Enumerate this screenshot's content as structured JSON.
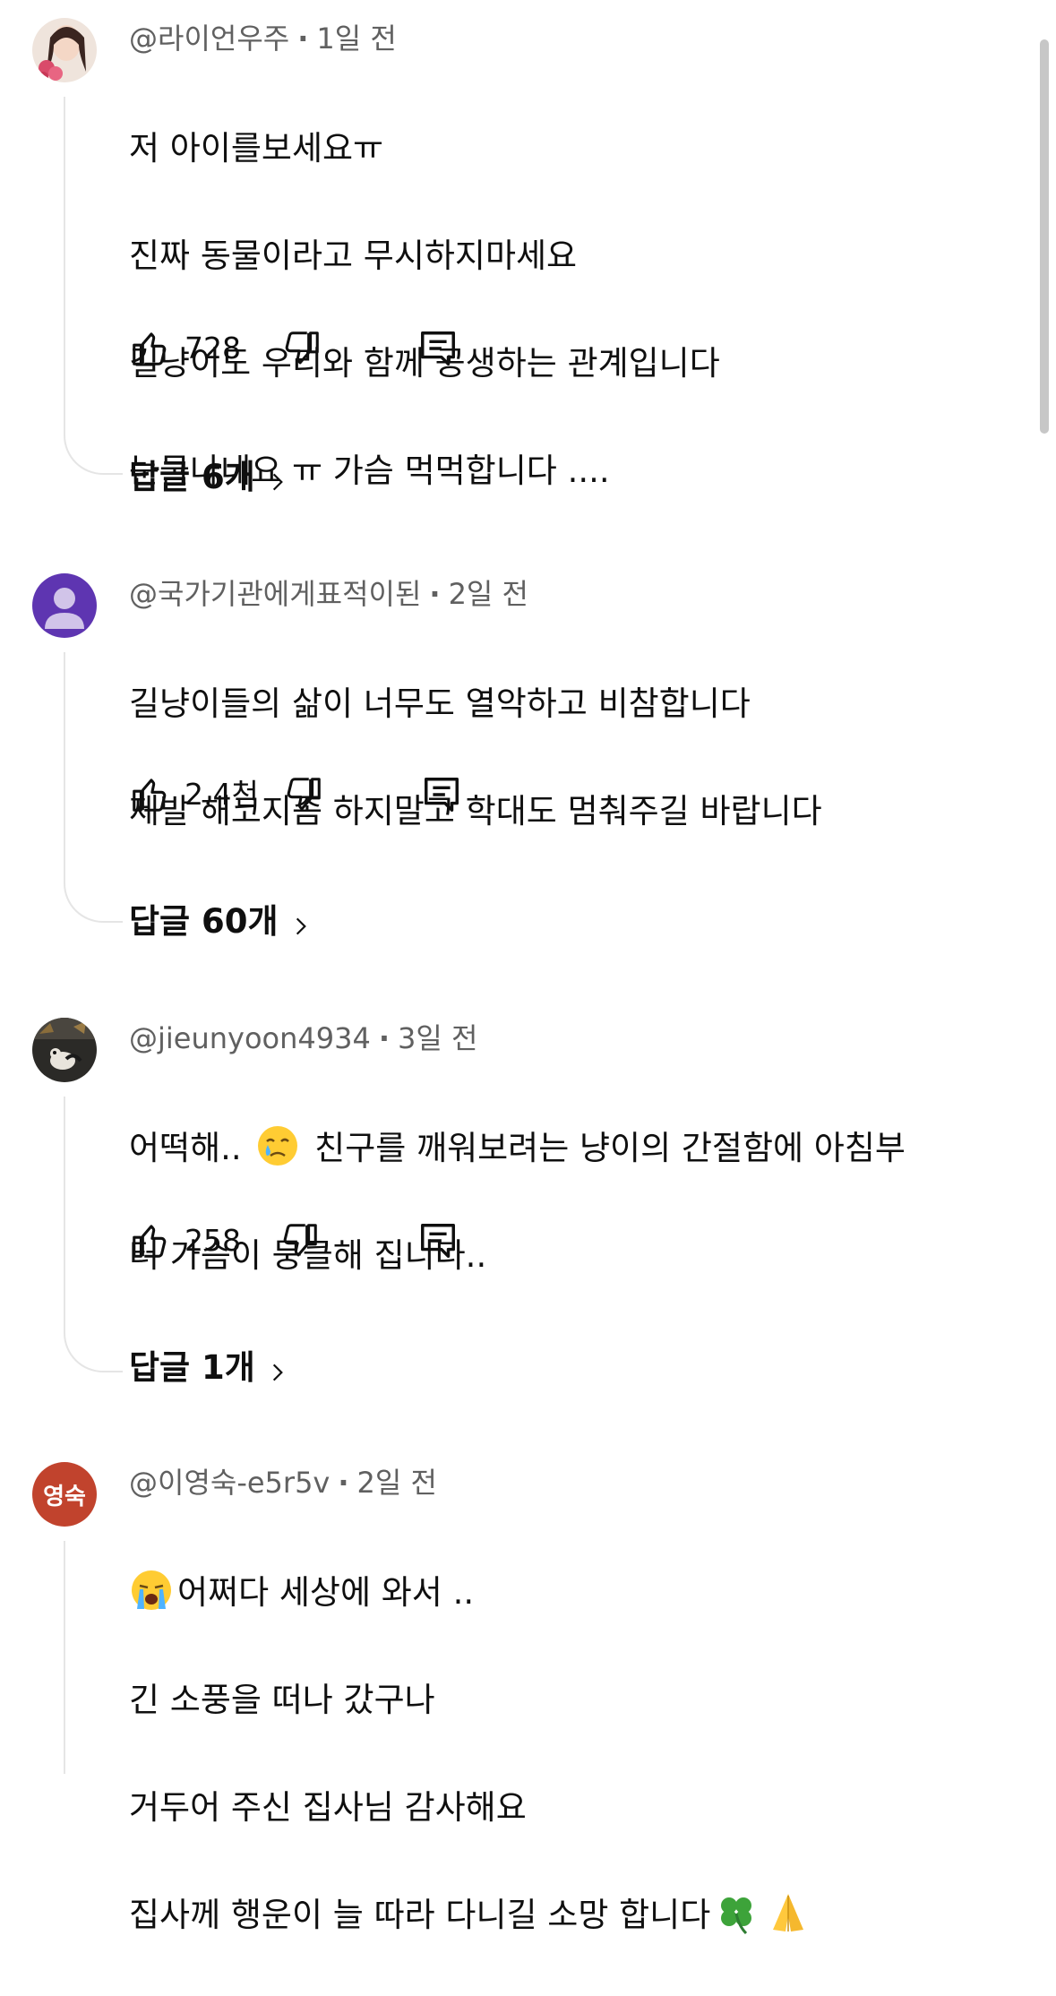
{
  "comments": [
    {
      "author": "@라이언우주",
      "time": "1일 전",
      "lines": [
        "저 아이를보세요ㅠ",
        "진짜  동물이라고 무시하지마세요",
        "길냥이도 우리와 함께 공생하는 관계입니다",
        "눈물나네요 ㅠ 가슴 먹먹합니다 ...."
      ],
      "likes": "728",
      "replies": "답글 6개",
      "avatar": "photo-woman-with-flowers"
    },
    {
      "author": "@국가기관에게표적이된",
      "time": "2일 전",
      "lines": [
        "길냥이들의 삶이 너무도 열악하고 비참합니다",
        "제발 해코지좀 하지말고 학대도 멈춰주길 바랍니다"
      ],
      "likes": "2.4천",
      "replies": "답글 60개",
      "avatar": "default-person",
      "avatar_color": "#5e35b1"
    },
    {
      "author": "@jieunyoon4934",
      "time": "3일 전",
      "line1_before": "어떡해.. ",
      "line1_after": " 친구를 깨워보려는 냥이의 간절함에 아침부",
      "line2": "터 가슴이 뭉클해 집니다..",
      "emoji": "crying-face",
      "likes": "258",
      "replies": "답글 1개",
      "avatar": "photo-dark-room-dog"
    },
    {
      "author": "@이영숙-e5r5v",
      "time": "2일 전",
      "avatar_text": "영숙",
      "avatar_color": "#c1432d",
      "line1": "어쩌다 세상에 와서 ..",
      "line2": "긴 소풍을 떠나 갔구나",
      "line3": "거두어 주신 집사님 감사해요",
      "line4": "집사께  행운이 늘 따라 다니길 소망 합니다",
      "emojis": [
        "loudly-crying-face",
        "four-leaf-clover",
        "folded-hands"
      ]
    }
  ],
  "icons": {
    "like": "thumbs-up-icon",
    "dislike": "thumbs-down-icon",
    "reply": "comment-reply-icon",
    "chevron": "chevron-right-icon"
  },
  "colors": {
    "meta_text": "#606060",
    "body_text": "#0f0f0f",
    "thread_line": "#e5e5e5"
  }
}
